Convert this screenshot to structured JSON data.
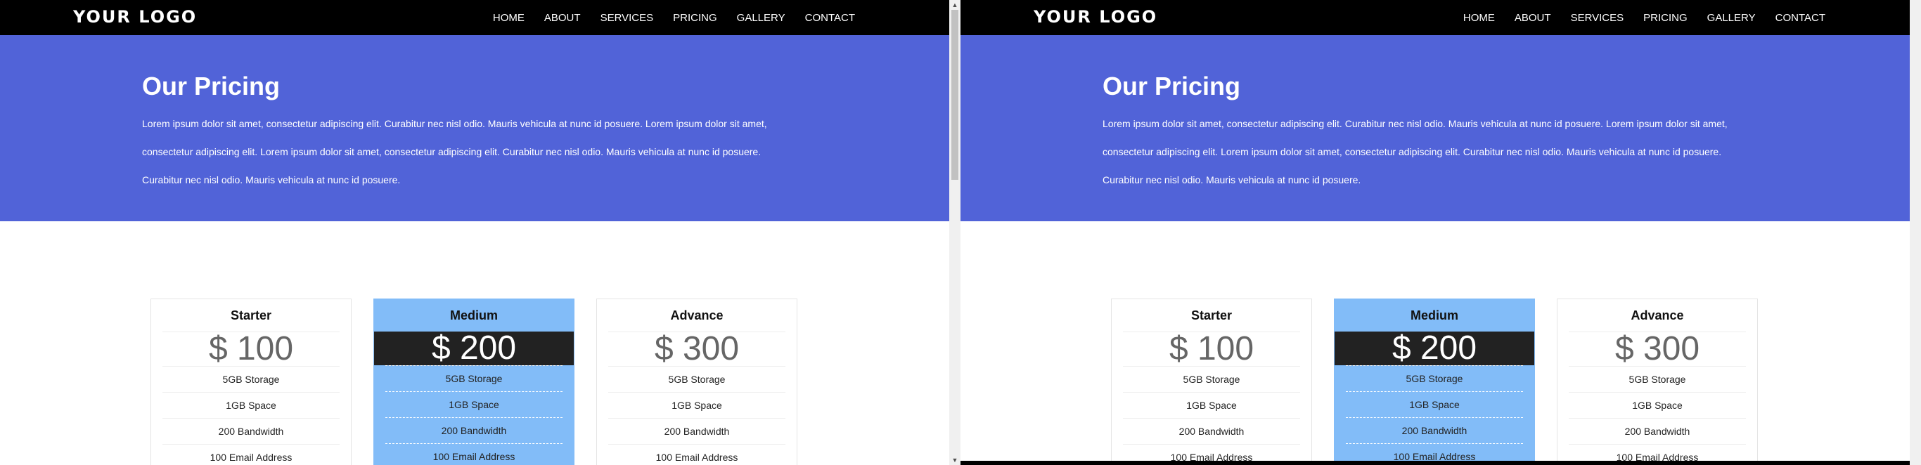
{
  "logo": "YOUR LOGO",
  "nav": [
    "HOME",
    "ABOUT",
    "SERVICES",
    "PRICING",
    "GALLERY",
    "CONTACT"
  ],
  "hero": {
    "title": "Our Pricing",
    "text": "Lorem ipsum dolor sit amet, consectetur adipiscing elit. Curabitur nec nisl odio. Mauris vehicula at nunc id posuere. Lorem ipsum dolor sit amet, consectetur adipiscing elit. Lorem ipsum dolor sit amet, consectetur adipiscing elit. Curabitur nec nisl odio. Mauris vehicula at nunc id posuere. Curabitur nec nisl odio. Mauris vehicula at nunc id posuere."
  },
  "plans": [
    {
      "name": "Starter",
      "price": "$ 100",
      "features": [
        "5GB Storage",
        "1GB Space",
        "200 Bandwidth",
        "100 Email Address"
      ]
    },
    {
      "name": "Medium",
      "price": "$ 200",
      "features": [
        "5GB Storage",
        "1GB Space",
        "200 Bandwidth",
        "100 Email Address"
      ]
    },
    {
      "name": "Advance",
      "price": "$ 300",
      "features": [
        "5GB Storage",
        "1GB Space",
        "200 Bandwidth",
        "100 Email Address"
      ]
    }
  ],
  "scrollbar": {
    "up_glyph": "▲",
    "down_glyph": "▼"
  },
  "colors": {
    "hero_bg": "#5163d8",
    "featured_bg": "#82bcf8",
    "price_band": "#222222",
    "nav_bg": "#000000"
  }
}
